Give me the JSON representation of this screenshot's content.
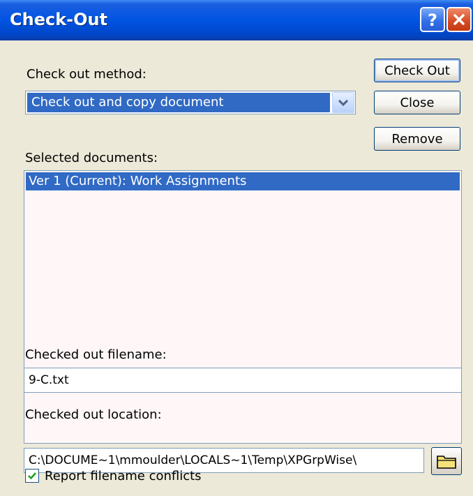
{
  "window": {
    "title": "Check-Out",
    "help_icon": "help-question-icon",
    "close_icon": "close-x-icon",
    "title_color": "#0054e3"
  },
  "method": {
    "label": "Check out method:",
    "selected": "Check out and copy document"
  },
  "buttons": {
    "check_out": "Check Out",
    "close": "Close",
    "remove": "Remove"
  },
  "documents": {
    "label": "Selected documents:",
    "items": [
      "Ver 1 (Current): Work Assignments"
    ]
  },
  "filename": {
    "label": "Checked out filename:",
    "value": "9-C.txt"
  },
  "location": {
    "label": "Checked out location:",
    "value": "C:\\DOCUME~1\\mmoulder\\LOCALS~1\\Temp\\XPGrpWise\\",
    "browse_icon": "folder-icon"
  },
  "report_conflicts": {
    "label": "Report filename conflicts",
    "checked": true
  },
  "colors": {
    "selection": "#316ac5",
    "dialog_bg": "#ece9d8"
  }
}
